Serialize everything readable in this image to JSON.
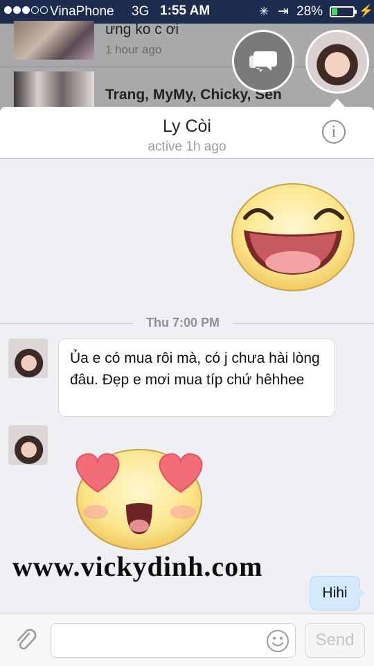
{
  "status_bar": {
    "carrier": "VinaPhone",
    "network": "3G",
    "time": "1:55 AM",
    "battery": "28%",
    "battery_level": 0.28,
    "signal_bars": 3
  },
  "background_list": [
    {
      "name": "ưng ko c ơi",
      "time": "1 hour ago"
    },
    {
      "name": "Trang, MyMy, Chicky, Sen",
      "time": ""
    }
  ],
  "chat_head": {
    "icon": "chat-bubbles-icon"
  },
  "conversation": {
    "title": "Ly Còi",
    "subtitle": "active 1h ago",
    "info_icon": "i"
  },
  "messages": {
    "timestamp": "Thu 7:00 PM",
    "incoming_text": "Ủa e có mua rôi mà, có j chưa hài lòng đâu. Đẹp e mơi mua típ chứ hêhhee",
    "outgoing_text": "Hihi"
  },
  "watermark": "www.vickydinh.com",
  "composer": {
    "placeholder": "",
    "send_label": "Send"
  },
  "colors": {
    "status_bar": "#1d2c4e",
    "incoming_bubble": "#ffffff",
    "outgoing_bubble": "#d4e9fb",
    "battery_fill": "#4cd964"
  }
}
